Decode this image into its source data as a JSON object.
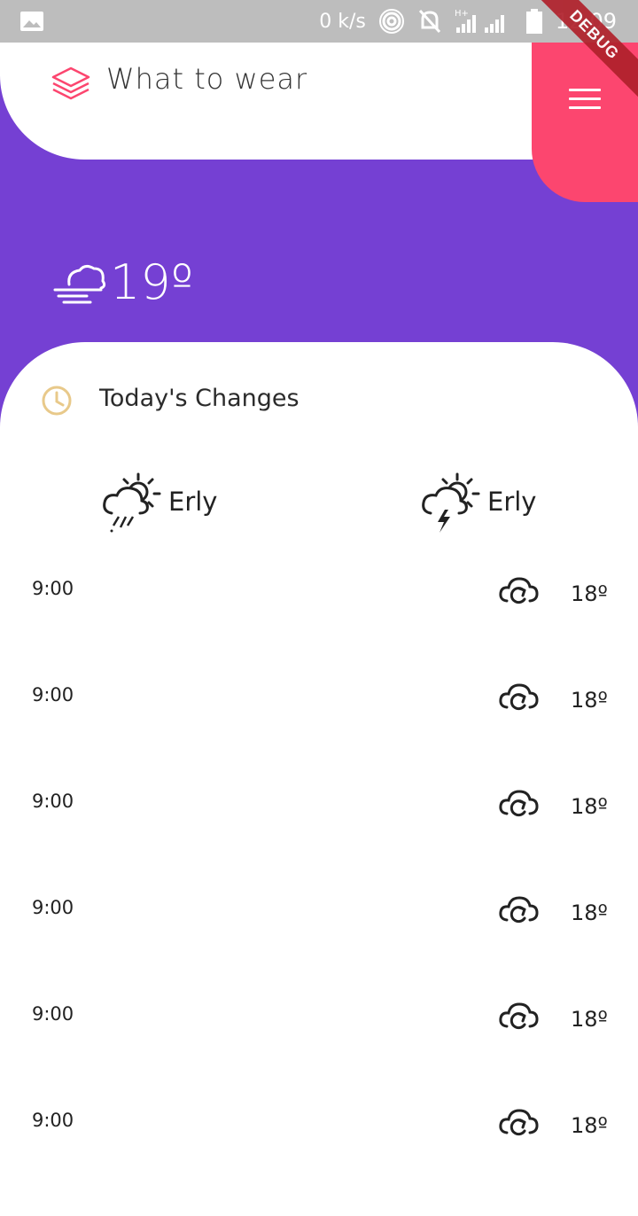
{
  "status_bar": {
    "speed": "0 k/s",
    "time": "12:09",
    "network_label": "H+"
  },
  "debug_ribbon": "DEBUG",
  "app": {
    "title": "What to wear",
    "logo_icon": "layers-icon",
    "menu_icon": "hamburger-menu-icon",
    "accent_color": "#fc466f",
    "hero_color": "#7540d3"
  },
  "current": {
    "icon": "cloud-wind-icon",
    "temp": "19º"
  },
  "changes": {
    "title": "Today's Changes",
    "icon": "clock-icon",
    "summary": [
      {
        "icon": "sun-cloud-rain-icon",
        "label": "Erly"
      },
      {
        "icon": "sun-cloud-lightning-icon",
        "label": "Erly"
      }
    ],
    "rows": [
      {
        "time": "9:00",
        "icon": "cloud-refresh-icon",
        "temp": "18º"
      },
      {
        "time": "9:00",
        "icon": "cloud-refresh-icon",
        "temp": "18º"
      },
      {
        "time": "9:00",
        "icon": "cloud-refresh-icon",
        "temp": "18º"
      },
      {
        "time": "9:00",
        "icon": "cloud-refresh-icon",
        "temp": "18º"
      },
      {
        "time": "9:00",
        "icon": "cloud-refresh-icon",
        "temp": "18º"
      },
      {
        "time": "9:00",
        "icon": "cloud-refresh-icon",
        "temp": "18º"
      }
    ]
  }
}
